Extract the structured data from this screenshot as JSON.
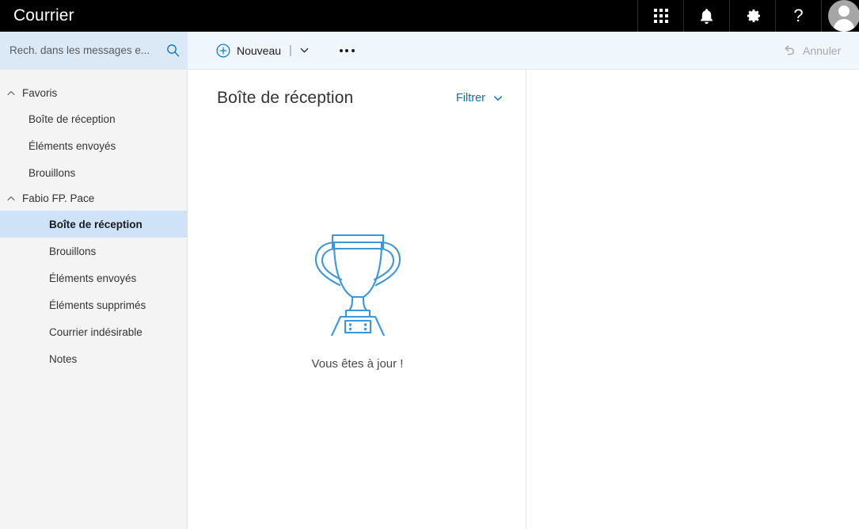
{
  "suite_bar": {
    "brand": "Courrier",
    "icons": [
      {
        "name": "app-launcher-icon",
        "label": "Lanceur d'applications"
      },
      {
        "name": "notifications-icon",
        "label": "Notifications"
      },
      {
        "name": "settings-icon",
        "label": "Paramètres"
      },
      {
        "name": "help-icon",
        "label": "?"
      }
    ],
    "avatar_label": "Compte"
  },
  "search": {
    "placeholder": "Rech. dans les messages e...",
    "value": "",
    "icon": "search-icon"
  },
  "command_bar": {
    "new_label": "Nouveau",
    "new_separator": "|",
    "new_icon": "circle-plus-icon",
    "new_chevron_icon": "chevron-down-icon",
    "more_label": "•••",
    "more_icon": "ellipsis-icon",
    "undo_label": "Annuler",
    "undo_icon": "undo-icon"
  },
  "folder_pane": {
    "groups": [
      {
        "label": "Favoris",
        "caret_icon": "chevron-up-icon",
        "items": [
          {
            "label": "Boîte de réception",
            "selected": false
          },
          {
            "label": "Éléments envoyés",
            "selected": false
          },
          {
            "label": "Brouillons",
            "selected": false
          }
        ]
      },
      {
        "label": "Fabio FP. Pace",
        "caret_icon": "chevron-up-icon",
        "items": [
          {
            "label": "Boîte de réception",
            "selected": true
          },
          {
            "label": "Brouillons",
            "selected": false
          },
          {
            "label": "Éléments envoyés",
            "selected": false
          },
          {
            "label": "Éléments supprimés",
            "selected": false
          },
          {
            "label": "Courrier indésirable",
            "selected": false
          },
          {
            "label": "Notes",
            "selected": false
          }
        ]
      }
    ]
  },
  "message_list": {
    "title": "Boîte de réception",
    "filter_label": "Filtrer",
    "filter_chevron_icon": "chevron-down-icon",
    "empty_state": {
      "illustration": "trophy-icon",
      "text": "Vous êtes à jour !"
    }
  },
  "reading_pane": {
    "content": ""
  },
  "colors": {
    "suite_bar_bg": "#000000",
    "command_bar_bg": "#eff6fc",
    "search_bg": "#dbe9f7",
    "folder_pane_bg": "#f4f4f4",
    "selected_folder_bg": "#cee3f7",
    "accent": "#0072c6",
    "illustration": "#3a96dd",
    "text": "#333333",
    "muted_text": "#a8a8a8"
  }
}
